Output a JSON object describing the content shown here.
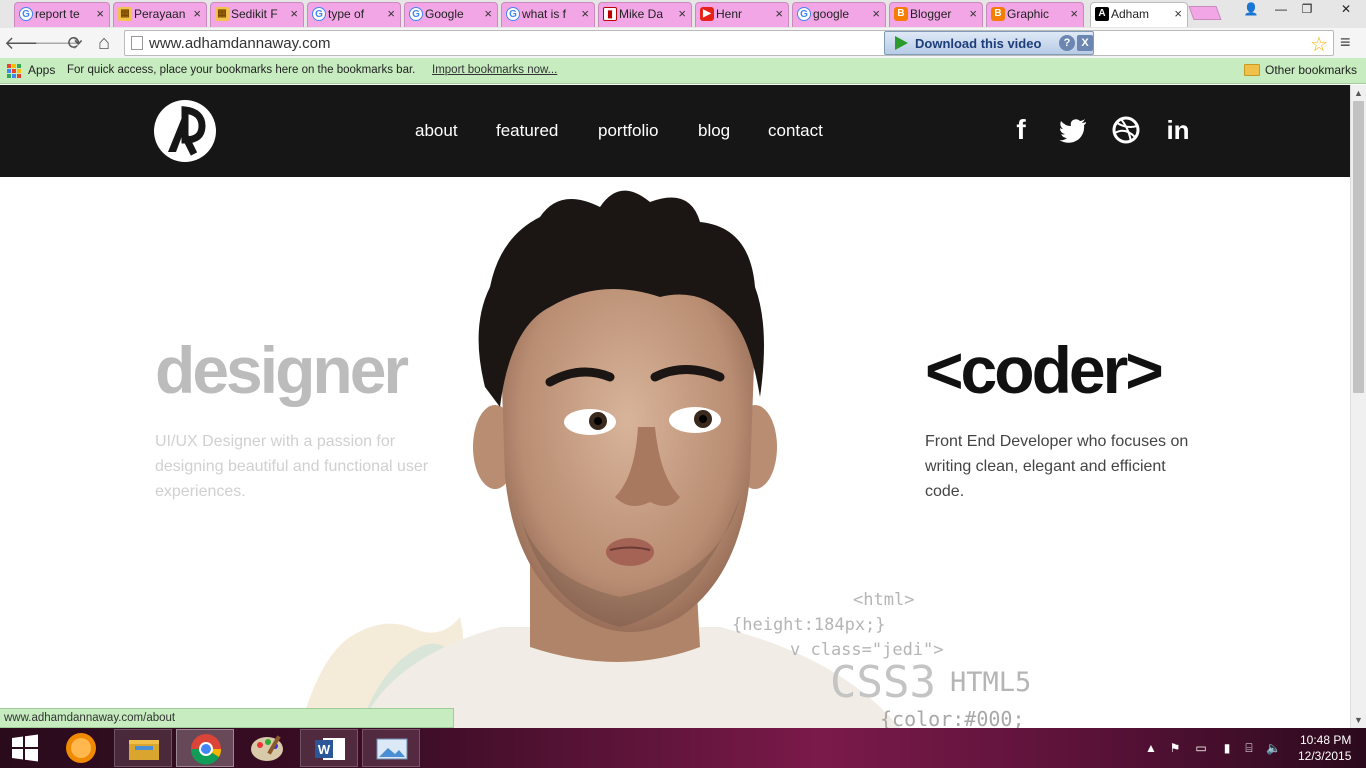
{
  "browser": {
    "tabs": [
      {
        "title": "report te",
        "favicon": "google-icon"
      },
      {
        "title": "Perayaan",
        "favicon": "image-icon"
      },
      {
        "title": "Sedikit F",
        "favicon": "image-icon"
      },
      {
        "title": "type of",
        "favicon": "google-icon"
      },
      {
        "title": "Google",
        "favicon": "google-icon"
      },
      {
        "title": "what is f",
        "favicon": "google-icon"
      },
      {
        "title": "Mike Da",
        "favicon": "bookmark-icon"
      },
      {
        "title": "Henr",
        "favicon": "youtube-icon"
      },
      {
        "title": "google",
        "favicon": "google-icon"
      },
      {
        "title": "Blogger",
        "favicon": "blogger-icon"
      },
      {
        "title": "Graphic",
        "favicon": "blogger-icon"
      },
      {
        "title": "Adham",
        "favicon": "adham-logo-icon"
      }
    ],
    "tab_close_glyph": "×",
    "window_controls": {
      "user": "👤",
      "minimize": "—",
      "restore": "❐",
      "close": "✕"
    },
    "nav": {
      "back": "🡐",
      "forward": "🡒",
      "reload": "⟳",
      "home": "⌂"
    },
    "url": "www.adhamdannaway.com",
    "download_video": {
      "label": "Download this video",
      "help": "?",
      "close": "X"
    },
    "star": "☆",
    "menu": "≡",
    "bookmarks_bar": {
      "apps_label": "Apps",
      "hint": "For quick access, place your bookmarks here on the bookmarks bar.",
      "import_link": "Import bookmarks now...",
      "other_bookmarks": "Other bookmarks"
    },
    "status_url": "www.adhamdannaway.com/about",
    "colors": {
      "tab_pink": "#f2a6e6",
      "bookmarks_green": "#c6ecbf"
    }
  },
  "site": {
    "nav": [
      "about",
      "featured",
      "portfolio",
      "blog",
      "contact"
    ],
    "social": [
      "facebook-icon",
      "twitter-icon",
      "dribbble-icon",
      "linkedin-icon"
    ],
    "social_glyphs": {
      "facebook": "f",
      "linkedin": "in"
    },
    "designer": {
      "title": "designer",
      "text": "UI/UX Designer with a passion for designing beautiful and functional user experiences."
    },
    "coder": {
      "title": "<coder>",
      "text": "Front End Developer who focuses on writing clean, elegant and efficient code."
    },
    "code_snippets": [
      "<html>",
      "{height:184px;}",
      "v class=\"jedi\">",
      "CSS3",
      "HTML5",
      "{color:#000;"
    ],
    "header_color": "#161616"
  },
  "taskbar": {
    "apps": [
      "windows-start",
      "vlc",
      "file-explorer",
      "chrome",
      "paint",
      "word",
      "photo-viewer"
    ],
    "time": "10:48 PM",
    "date": "12/3/2015"
  }
}
